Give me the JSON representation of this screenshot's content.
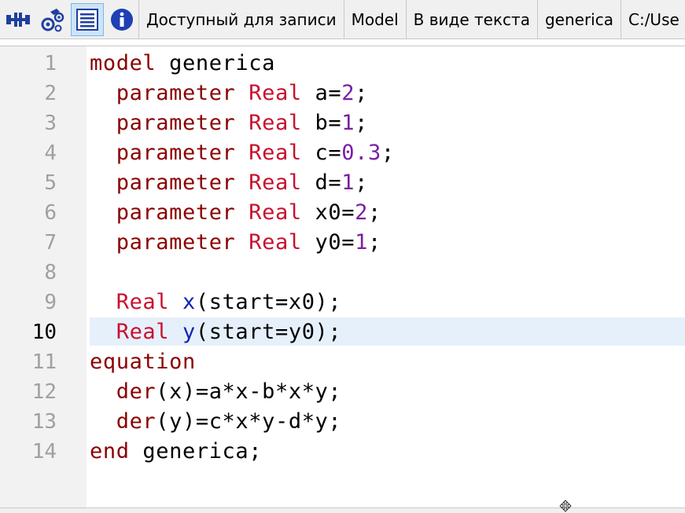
{
  "toolbar": {
    "icons": [
      {
        "name": "diagram-view-icon",
        "active": false
      },
      {
        "name": "icon-view-icon",
        "active": false
      },
      {
        "name": "text-view-icon",
        "active": true
      },
      {
        "name": "info-icon",
        "active": false
      }
    ],
    "segments": {
      "access": "Доступный для записи",
      "kind": "Model",
      "view": "В виде текста",
      "name": "generica",
      "path": "C:/Use"
    }
  },
  "editor": {
    "current_line": 10,
    "lines": [
      {
        "n": "1",
        "tokens": [
          {
            "t": "model ",
            "c": "kw"
          },
          {
            "t": "generica",
            "c": "plain"
          }
        ]
      },
      {
        "n": "2",
        "tokens": [
          {
            "t": "  parameter ",
            "c": "kw"
          },
          {
            "t": "Real ",
            "c": "ty"
          },
          {
            "t": "a=",
            "c": "plain"
          },
          {
            "t": "2",
            "c": "num"
          },
          {
            "t": ";",
            "c": "plain"
          }
        ]
      },
      {
        "n": "3",
        "tokens": [
          {
            "t": "  parameter ",
            "c": "kw"
          },
          {
            "t": "Real ",
            "c": "ty"
          },
          {
            "t": "b=",
            "c": "plain"
          },
          {
            "t": "1",
            "c": "num"
          },
          {
            "t": ";",
            "c": "plain"
          }
        ]
      },
      {
        "n": "4",
        "tokens": [
          {
            "t": "  parameter ",
            "c": "kw"
          },
          {
            "t": "Real ",
            "c": "ty"
          },
          {
            "t": "c=",
            "c": "plain"
          },
          {
            "t": "0.3",
            "c": "num"
          },
          {
            "t": ";",
            "c": "plain"
          }
        ]
      },
      {
        "n": "5",
        "tokens": [
          {
            "t": "  parameter ",
            "c": "kw"
          },
          {
            "t": "Real ",
            "c": "ty"
          },
          {
            "t": "d=",
            "c": "plain"
          },
          {
            "t": "1",
            "c": "num"
          },
          {
            "t": ";",
            "c": "plain"
          }
        ]
      },
      {
        "n": "6",
        "tokens": [
          {
            "t": "  parameter ",
            "c": "kw"
          },
          {
            "t": "Real ",
            "c": "ty"
          },
          {
            "t": "x0=",
            "c": "plain"
          },
          {
            "t": "2",
            "c": "num"
          },
          {
            "t": ";",
            "c": "plain"
          }
        ]
      },
      {
        "n": "7",
        "tokens": [
          {
            "t": "  parameter ",
            "c": "kw"
          },
          {
            "t": "Real ",
            "c": "ty"
          },
          {
            "t": "y0=",
            "c": "plain"
          },
          {
            "t": "1",
            "c": "num"
          },
          {
            "t": ";",
            "c": "plain"
          }
        ]
      },
      {
        "n": "8",
        "tokens": []
      },
      {
        "n": "9",
        "tokens": [
          {
            "t": "  Real ",
            "c": "ty"
          },
          {
            "t": "x",
            "c": "var"
          },
          {
            "t": "(start=x0);",
            "c": "plain"
          }
        ]
      },
      {
        "n": "10",
        "tokens": [
          {
            "t": "  Real ",
            "c": "ty"
          },
          {
            "t": "y",
            "c": "var"
          },
          {
            "t": "(start=y0);",
            "c": "plain"
          }
        ]
      },
      {
        "n": "11",
        "tokens": [
          {
            "t": "equation",
            "c": "kw"
          }
        ]
      },
      {
        "n": "12",
        "tokens": [
          {
            "t": "  der",
            "c": "kw"
          },
          {
            "t": "(x)=a*x-b*x*y;",
            "c": "plain"
          }
        ]
      },
      {
        "n": "13",
        "tokens": [
          {
            "t": "  der",
            "c": "kw"
          },
          {
            "t": "(y)=c*x*y-d*y;",
            "c": "plain"
          }
        ]
      },
      {
        "n": "14",
        "tokens": [
          {
            "t": "end ",
            "c": "kw"
          },
          {
            "t": "generica;",
            "c": "plain"
          }
        ]
      }
    ]
  },
  "colors": {
    "keyword": "#8b0000",
    "type": "#c8102e",
    "number": "#7a1fa2",
    "variable": "#1024b8",
    "current_line_bg": "#e6f0fb",
    "gutter_bg": "#f2f2f2"
  }
}
